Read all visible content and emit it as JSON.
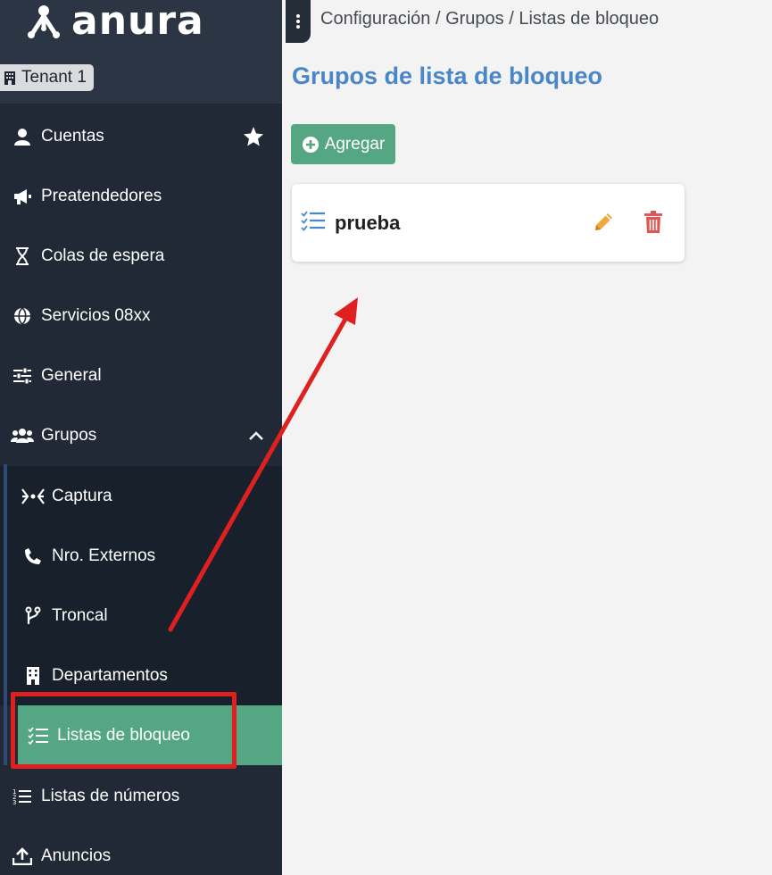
{
  "brand": {
    "name": "anura"
  },
  "tenant": {
    "label": "Tenant 1"
  },
  "sidebar": {
    "items": [
      {
        "label": "Cuentas",
        "icon": "user-icon"
      },
      {
        "label": "Preatendedores",
        "icon": "megaphone-icon"
      },
      {
        "label": "Colas de espera",
        "icon": "hourglass-icon"
      },
      {
        "label": "Servicios 08xx",
        "icon": "globe-icon"
      },
      {
        "label": "General",
        "icon": "sliders-icon"
      },
      {
        "label": "Grupos",
        "icon": "users-icon"
      }
    ],
    "subitems": [
      {
        "label": "Captura",
        "icon": "capture-icon"
      },
      {
        "label": "Nro. Externos",
        "icon": "phone-icon"
      },
      {
        "label": "Troncal",
        "icon": "branch-icon"
      },
      {
        "label": "Departamentos",
        "icon": "building-icon"
      },
      {
        "label": "Listas de bloqueo",
        "icon": "checklist-icon",
        "active": true
      }
    ],
    "after": [
      {
        "label": "Listas de números",
        "icon": "numbered-list-icon"
      },
      {
        "label": "Anuncios",
        "icon": "upload-icon"
      }
    ]
  },
  "breadcrumb": "Configuración / Grupos / Listas de bloqueo",
  "page_title": "Grupos de lista de bloqueo",
  "add_button": "Agregar",
  "cards": [
    {
      "name": "prueba"
    }
  ],
  "colors": {
    "accent_green": "#55a783",
    "title_blue": "#4a86c8",
    "annotation_red": "#e02020",
    "edit_orange": "#f0a93a",
    "delete_red": "#e05555"
  }
}
